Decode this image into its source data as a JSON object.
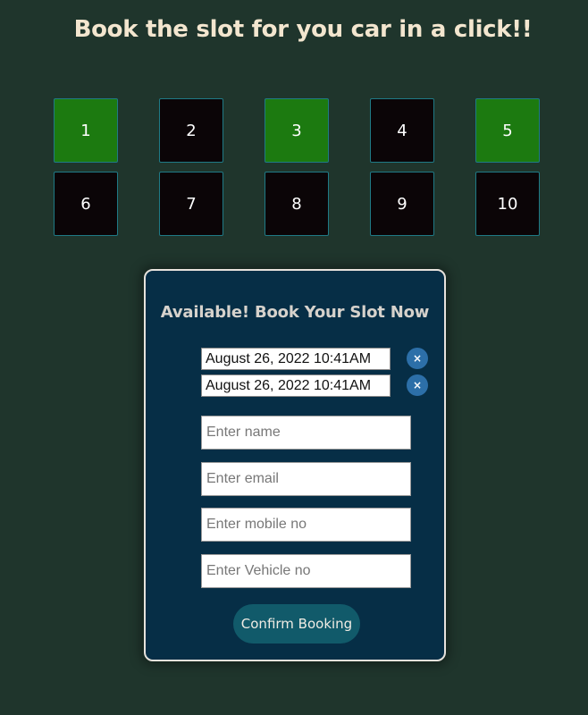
{
  "header": {
    "title": "Book the slot for you car in a click!!"
  },
  "colors": {
    "background": "#1f352c",
    "slot_available": "#1c7a10",
    "slot_booked": "#0b0507",
    "card_background": "#062e46",
    "button": "#115a6a"
  },
  "slots": [
    {
      "label": "1",
      "status": "available"
    },
    {
      "label": "2",
      "status": "booked"
    },
    {
      "label": "3",
      "status": "available"
    },
    {
      "label": "4",
      "status": "booked"
    },
    {
      "label": "5",
      "status": "available"
    },
    {
      "label": "6",
      "status": "booked"
    },
    {
      "label": "7",
      "status": "booked"
    },
    {
      "label": "8",
      "status": "booked"
    },
    {
      "label": "9",
      "status": "booked"
    },
    {
      "label": "10",
      "status": "booked"
    }
  ],
  "booking": {
    "heading": "Available! Book Your Slot Now",
    "dates": [
      {
        "value": "August 26, 2022 10:41AM",
        "clear_label": "×"
      },
      {
        "value": "August 26, 2022 10:41AM",
        "clear_label": "×"
      }
    ],
    "fields": {
      "name": {
        "placeholder": "Enter name",
        "value": ""
      },
      "email": {
        "placeholder": "Enter email",
        "value": ""
      },
      "mobile": {
        "placeholder": "Enter mobile no",
        "value": ""
      },
      "vehicle": {
        "placeholder": "Enter Vehicle no",
        "value": ""
      }
    },
    "confirm_label": "Confirm Booking"
  }
}
